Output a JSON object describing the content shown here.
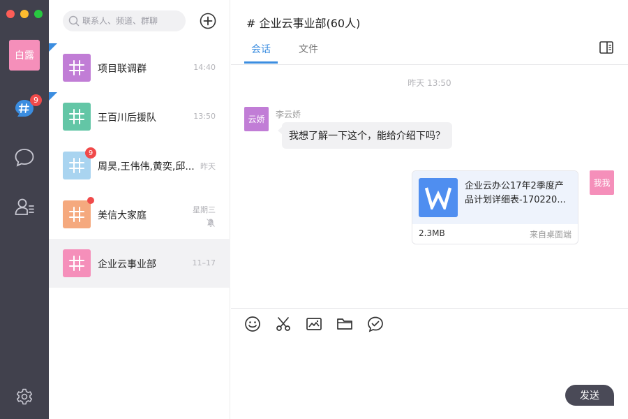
{
  "user": {
    "avatar_text": "白露",
    "avatar_color": "#f58fba"
  },
  "rail": {
    "chat_badge": "9"
  },
  "search": {
    "placeholder": "联系人、频道、群聊"
  },
  "conversations": [
    {
      "name": "项目联调群",
      "time": "14:40",
      "color": "#c17dd6",
      "flag": true
    },
    {
      "name": "王百川后援队",
      "time": "13:50",
      "color": "#63c6a6",
      "flag": true
    },
    {
      "name": "周昊,王伟伟,黄奕,邱...",
      "time": "昨天",
      "color": "#a9d4f0",
      "badge": "9"
    },
    {
      "name": "美信大家庭",
      "time": "星期三",
      "color": "#f5a97e",
      "dot": true,
      "muted": true
    },
    {
      "name": "企业云事业部",
      "time": "11–17",
      "color": "#f58fba",
      "active": true
    }
  ],
  "chat": {
    "title": "# 企业云事业部(60人)",
    "tabs": [
      {
        "label": "会话",
        "active": true
      },
      {
        "label": "文件",
        "active": false
      }
    ],
    "timestamp": "昨天  13:50",
    "incoming": {
      "avatar_text": "云娇",
      "avatar_color": "#c17dd6",
      "sender": "李云娇",
      "text": "我想了解一下这个，能给介绍下吗？"
    },
    "outgoing": {
      "avatar_text": "我我",
      "avatar_color": "#f58fba",
      "file": {
        "name_line1": "企业云办公17年2季度产",
        "name_line2": "品计划详细表-170220...",
        "size": "2.3MB",
        "source": "来自桌面端",
        "icon_color": "#4f8ef0"
      }
    },
    "composer": {
      "tools": [
        "smiley-icon",
        "scissors-icon",
        "image-icon",
        "folder-icon",
        "chat-check-icon"
      ],
      "send_label": "发送"
    }
  },
  "colors": {
    "accent": "#3b8de0",
    "rail": "#41414d",
    "badge": "#f04a4a"
  }
}
